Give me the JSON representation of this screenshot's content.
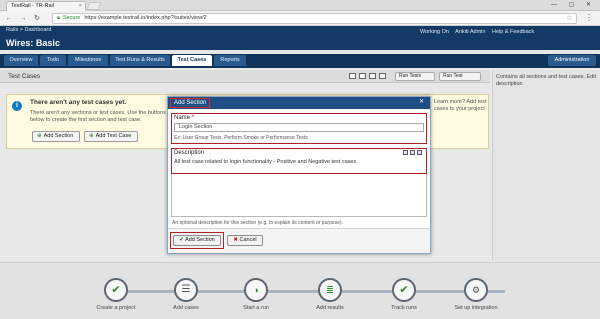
{
  "browser": {
    "tab_title": "TestRail - TR-Rail",
    "tab_close": "×",
    "window_controls": "— ▢ ✕",
    "secure_label": "Secure",
    "url": "https://example.testrail.io/index.php?/suites/view/2",
    "nav_icons": [
      "back-icon",
      "forward-icon",
      "reload-icon"
    ]
  },
  "app": {
    "breadcrumb": "Rails > Dashboard",
    "title": "Wires: Basic",
    "user_links": [
      "Working On",
      "Ankiti Admin",
      "Help & Feedback"
    ],
    "admin_label": "Administration",
    "nav_tabs": [
      {
        "label": "Overview",
        "active": false
      },
      {
        "label": "Todo",
        "active": false
      },
      {
        "label": "Milestones",
        "active": false
      },
      {
        "label": "Test Runs & Results",
        "active": false
      },
      {
        "label": "Test Cases",
        "active": true
      },
      {
        "label": "Reports",
        "active": false
      }
    ]
  },
  "page": {
    "title": "Test Cases",
    "toolbar_btn1": "Run Tests",
    "toolbar_btn2": "Run Test",
    "right_panel": "Contains all sections and test cases. Edit description",
    "behind_right": "Learn more? Add test cases to your project"
  },
  "info_box": {
    "title": "There aren't any test cases yet.",
    "body": "There aren't any sections or test cases. Use the buttons below to create the first section and test case.",
    "btn_add_section": "Add Section",
    "btn_add_test_case": "Add Test Case"
  },
  "modal": {
    "title": "Add Section",
    "close": "✕",
    "name_label": "Name",
    "name_required": "*",
    "name_value": "Login Section",
    "name_hint": "Ex: User Group Tests, Perform Smoke or Performance Tests",
    "desc_label": "Description",
    "desc_value": "All test case related to login functionality - Positive and Negative test cases",
    "desc_help": "An optional description for this section (e.g. to explain its content or purpose).",
    "add_button": "Add Section",
    "cancel_button": "Cancel"
  },
  "workflow": {
    "steps": [
      {
        "label": "Create a project",
        "icon": "checkmark-icon"
      },
      {
        "label": "Add cases",
        "icon": "list-icon"
      },
      {
        "label": "Start a run",
        "icon": "play-icon"
      },
      {
        "label": "Add results",
        "icon": "results-icon"
      },
      {
        "label": "Track runs",
        "icon": "checkmark-icon"
      },
      {
        "label": "Set up integration",
        "icon": "integration-icon"
      }
    ]
  },
  "colors": {
    "header": "#123a64",
    "modal_header": "#1f4e86",
    "highlight": "#b02323",
    "success": "#2e8a2e"
  }
}
